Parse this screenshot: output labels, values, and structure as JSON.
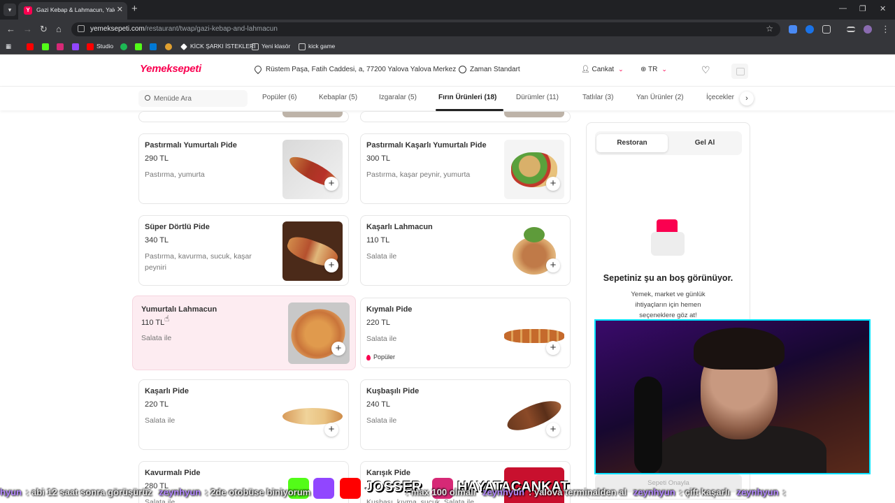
{
  "browser": {
    "tab_title": "Gazi Kebap & Lahmacun, Yalova",
    "url_domain": "yemeksepeti.com",
    "url_path": "/restaurant/twap/gazi-kebap-and-lahmacun",
    "bookmarks": [
      "Studio",
      "KİCK ŞARKI İSTEKLERİ",
      "Yeni klasör",
      "kick game"
    ]
  },
  "header": {
    "logo": "Yemeksepeti",
    "address": "Rüstem Paşa, Fatih Caddesi, a, 77200 Yalova Yalova Merkez",
    "delivery": "Zaman Standart",
    "user": "Cankat",
    "language": "TR"
  },
  "catnav": {
    "search_placeholder": "Menüde Ara",
    "categories": [
      "Popüler (6)",
      "Kebaplar (5)",
      "Izgaralar (5)",
      "Fırın Ürünleri (18)",
      "Dürümler (11)",
      "Tatlılar (3)",
      "Yan Ürünler (2)",
      "İçecekler"
    ],
    "active_index": 3
  },
  "menu": [
    {
      "name": "Pastırmalı Yumurtalı Pide",
      "price": "290 TL",
      "desc": "Pastırma, yumurta"
    },
    {
      "name": "Pastırmalı Kaşarlı Yumurtalı Pide",
      "price": "300 TL",
      "desc": "Pastırma, kaşar peynir, yumurta"
    },
    {
      "name": "Süper Dörtlü Pide",
      "price": "340 TL",
      "desc": "Pastırma, kavurma, sucuk, kaşar peyniri"
    },
    {
      "name": "Kaşarlı Lahmacun",
      "price": "110 TL",
      "desc": "Salata ile"
    },
    {
      "name": "Yumurtalı Lahmacun",
      "price": "110 TL",
      "desc": "Salata ile"
    },
    {
      "name": "Kıymalı Pide",
      "price": "220 TL",
      "desc": "Salata ile",
      "badge": "Popüler"
    },
    {
      "name": "Kaşarlı Pide",
      "price": "220 TL",
      "desc": "Salata ile"
    },
    {
      "name": "Kuşbaşılı Pide",
      "price": "240 TL",
      "desc": "Salata ile"
    },
    {
      "name": "Kavurmalı Pide",
      "price": "280 TL",
      "desc": "Salata ile"
    },
    {
      "name": "Karışık Pide",
      "price": "",
      "desc": "Kuşbaşı, kıyma, sucuk, Salata ile"
    }
  ],
  "cart": {
    "tab_on": "Restoran",
    "tab_off": "Gel Al",
    "empty_title": "Sepetiniz şu an boş görünüyor.",
    "empty_desc": "Yemek, market ve günlük ihtiyaçların için hemen seçeneklere göz at!",
    "checkout": "Sepeti Onayla"
  },
  "stream": {
    "ticker": [
      {
        "user": "hyun",
        "msg": ": abi 12 saat sonra görüşürüz"
      },
      {
        "user": "zeynhyun",
        "msg": ": 2de otobüse biniyorum"
      },
      {
        "user": "",
        "msg": ": max 100 olmalı"
      },
      {
        "user": "zeynhyun",
        "msg": ": yalova terminalden al"
      },
      {
        "user": "zeynhyun",
        "msg": ": çift kaşarlı"
      },
      {
        "user": "zeynhyun",
        "msg": ":"
      }
    ],
    "brand_left": "JOSSER",
    "brand_right": "HAYATACANKAT"
  },
  "colors": {
    "brand": "#fa0050",
    "cam_border": "#00e1ff",
    "hover_card": "#fdecf1"
  }
}
